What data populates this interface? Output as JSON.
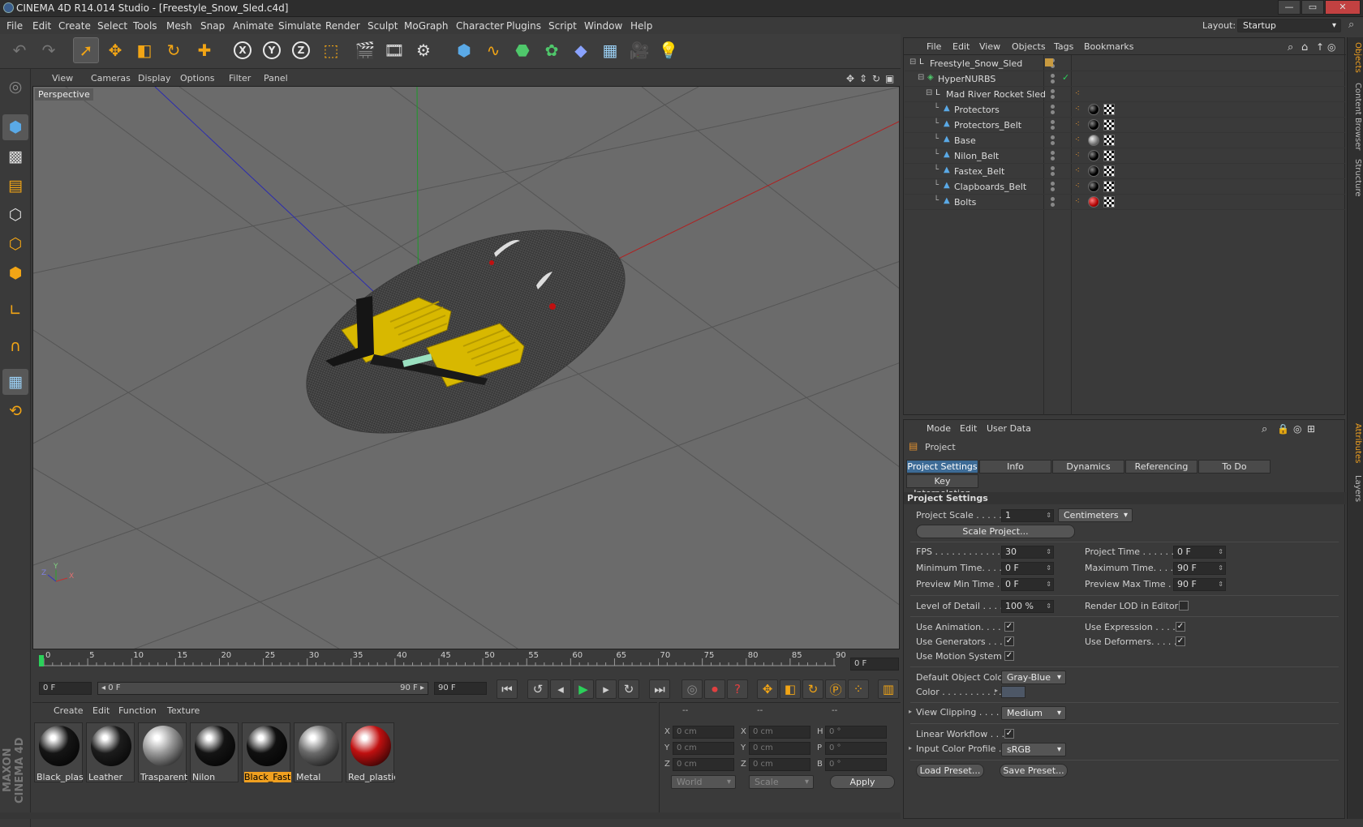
{
  "window": {
    "title": "CINEMA 4D R14.014 Studio - [Freestyle_Snow_Sled.c4d]",
    "min": "—",
    "max": "▭",
    "close": "✕"
  },
  "menu": [
    "File",
    "Edit",
    "Create",
    "Select",
    "Tools",
    "Mesh",
    "Snap",
    "Animate",
    "Simulate",
    "Render",
    "Sculpt",
    "MoGraph",
    "Character",
    "Plugins",
    "Script",
    "Window",
    "Help"
  ],
  "layout": {
    "label": "Layout:",
    "value": "Startup"
  },
  "viewport": {
    "menu": [
      "View",
      "Cameras",
      "Display",
      "Options",
      "Filter",
      "Panel"
    ],
    "label": "Perspective",
    "axes": {
      "x": "X",
      "y": "Y",
      "z": "Z"
    }
  },
  "timeline": {
    "ticks": [
      "0",
      "5",
      "10",
      "15",
      "20",
      "25",
      "30",
      "35",
      "40",
      "45",
      "50",
      "55",
      "60",
      "65",
      "70",
      "75",
      "80",
      "85",
      "90"
    ],
    "current_frame": "0 F",
    "start": "0 F",
    "slider_left": "◂ 0 F",
    "slider_right": "90 F ▸",
    "end": "90 F"
  },
  "materials": {
    "menu": [
      "Create",
      "Edit",
      "Function",
      "Texture"
    ],
    "items": [
      {
        "name": "Black_plast",
        "color": "#151515",
        "highlight": false
      },
      {
        "name": "Leather",
        "color": "#1c1c1c",
        "highlight": false
      },
      {
        "name": "Trasparent",
        "color": "#9a9a9a",
        "highlight": false
      },
      {
        "name": "Nilon",
        "color": "#141414",
        "highlight": false
      },
      {
        "name": "Black_Faste",
        "color": "#101010",
        "highlight": true
      },
      {
        "name": "Metal",
        "color": "#6a6a6a",
        "highlight": false
      },
      {
        "name": "Red_plastic",
        "color": "#c01010",
        "highlight": false
      }
    ]
  },
  "coords": {
    "header": [
      "--",
      "--",
      "--"
    ],
    "rows": [
      {
        "a": "X",
        "av": "0 cm",
        "b": "X",
        "bv": "0 cm",
        "c": "H",
        "cv": "0 °"
      },
      {
        "a": "Y",
        "av": "0 cm",
        "b": "Y",
        "bv": "0 cm",
        "c": "P",
        "cv": "0 °"
      },
      {
        "a": "Z",
        "av": "0 cm",
        "b": "Z",
        "bv": "0 cm",
        "c": "B",
        "cv": "0 °"
      }
    ],
    "world": "World",
    "scale": "Scale",
    "apply": "Apply"
  },
  "brand": "MAXON CINEMA 4D",
  "objects": {
    "menu": [
      "File",
      "Edit",
      "View",
      "Objects",
      "Tags",
      "Bookmarks"
    ],
    "tree": [
      {
        "name": "Freestyle_Snow_Sled",
        "indent": 0,
        "tags": "layer"
      },
      {
        "name": "HyperNURBS",
        "indent": 1,
        "tags": "check"
      },
      {
        "name": "Mad River Rocket Sled",
        "indent": 2,
        "tags": "phong"
      },
      {
        "name": "Protectors",
        "indent": 3,
        "tags": "black"
      },
      {
        "name": "Protectors_Belt",
        "indent": 3,
        "tags": "black"
      },
      {
        "name": "Base",
        "indent": 3,
        "tags": "trans"
      },
      {
        "name": "Nilon_Belt",
        "indent": 3,
        "tags": "black"
      },
      {
        "name": "Fastex_Belt",
        "indent": 3,
        "tags": "black"
      },
      {
        "name": "Clapboards_Belt",
        "indent": 3,
        "tags": "black"
      },
      {
        "name": "Bolts",
        "indent": 3,
        "tags": "red"
      }
    ]
  },
  "attributes": {
    "menu": [
      "Mode",
      "Edit",
      "User Data"
    ],
    "object": "Project",
    "tabs": [
      "Project Settings",
      "Info",
      "Dynamics",
      "Referencing",
      "To Do"
    ],
    "tab2": "Key Interpolation",
    "section": "Project Settings",
    "project_scale": {
      "label": "Project Scale . . . . . .",
      "value": "1",
      "unit": "Centimeters"
    },
    "scale_btn": "Scale Project...",
    "fps": {
      "label": "FPS . . . . . . . . . . . . . . .",
      "value": "30"
    },
    "min_time": {
      "label": "Minimum Time. . . . . .",
      "value": "0 F"
    },
    "prev_min": {
      "label": "Preview Min Time . .",
      "value": "0 F"
    },
    "proj_time": {
      "label": "Project Time . . . . . . . .",
      "value": "0 F"
    },
    "max_time": {
      "label": "Maximum Time. . . . . .",
      "value": "90 F"
    },
    "prev_max": {
      "label": "Preview Max Time . . .",
      "value": "90 F"
    },
    "lod": {
      "label": "Level of Detail . . . . .",
      "value": "100 %"
    },
    "render_lod": "Render LOD in Editor",
    "use_anim": "Use Animation. . . . .",
    "use_gen": "Use Generators . . . .",
    "use_motion": "Use Motion System",
    "use_expr": "Use Expression . . . . .",
    "use_def": "Use Deformers. . . . . .",
    "def_color": {
      "label": "Default Object Color",
      "value": "Gray-Blue"
    },
    "color": "Color . . . . . . . . . . .",
    "clipping": {
      "label": "View Clipping . . . . .",
      "value": "Medium"
    },
    "linear": "Linear Workflow . . . .",
    "icp": {
      "label": "Input Color Profile . .",
      "value": "sRGB"
    },
    "load": "Load Preset...",
    "save": "Save Preset..."
  },
  "side_tabs": [
    "Objects",
    "Content Browser",
    "Structure",
    "Attributes",
    "Layers"
  ]
}
